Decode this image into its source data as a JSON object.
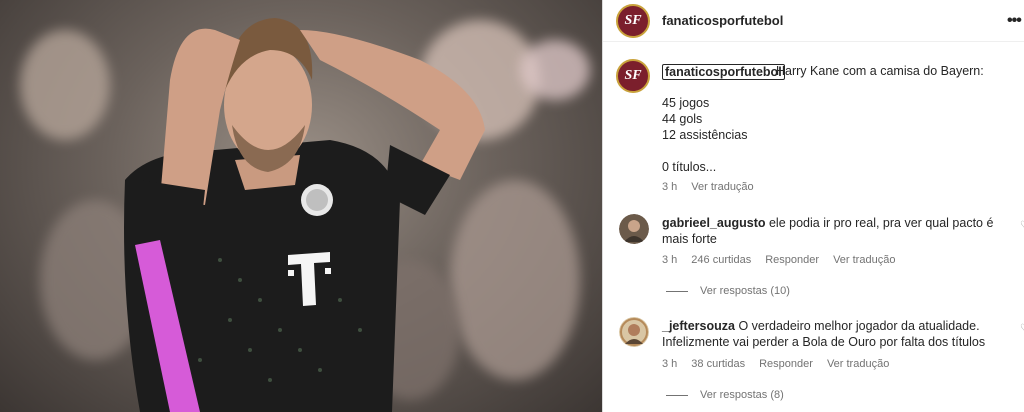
{
  "header": {
    "username": "fanaticosporfutebol",
    "avatar_text": "SF",
    "more_icon": "more-options-icon"
  },
  "caption": {
    "username": "fanaticosporfutebol",
    "intro": "Harry Kane com a camisa do Bayern:",
    "lines": [
      "45 jogos",
      "44 gols",
      "12 assistências",
      "0 títulos..."
    ],
    "time": "3 h",
    "translate": "Ver tradução"
  },
  "comments": [
    {
      "username": "gabrieel_augusto",
      "text": "ele podia ir pro real, pra ver qual pacto é mais forte",
      "time": "3 h",
      "likes": "246 curtidas",
      "reply": "Responder",
      "translate": "Ver tradução",
      "view_replies": "Ver respostas (10)"
    },
    {
      "username": "_jeftersouza",
      "text": "O verdadeiro melhor jogador da atualidade. Infelizmente vai perder a Bola de Ouro por falta dos títulos",
      "time": "3 h",
      "likes": "38 curtidas",
      "reply": "Responder",
      "translate": "Ver tradução",
      "view_replies": "Ver respostas (8)"
    }
  ],
  "colors": {
    "brand": "#7b1f2c",
    "jersey": "#1a1a1a",
    "accent_pink": "#d65bd8",
    "muted_text": "#737373"
  }
}
